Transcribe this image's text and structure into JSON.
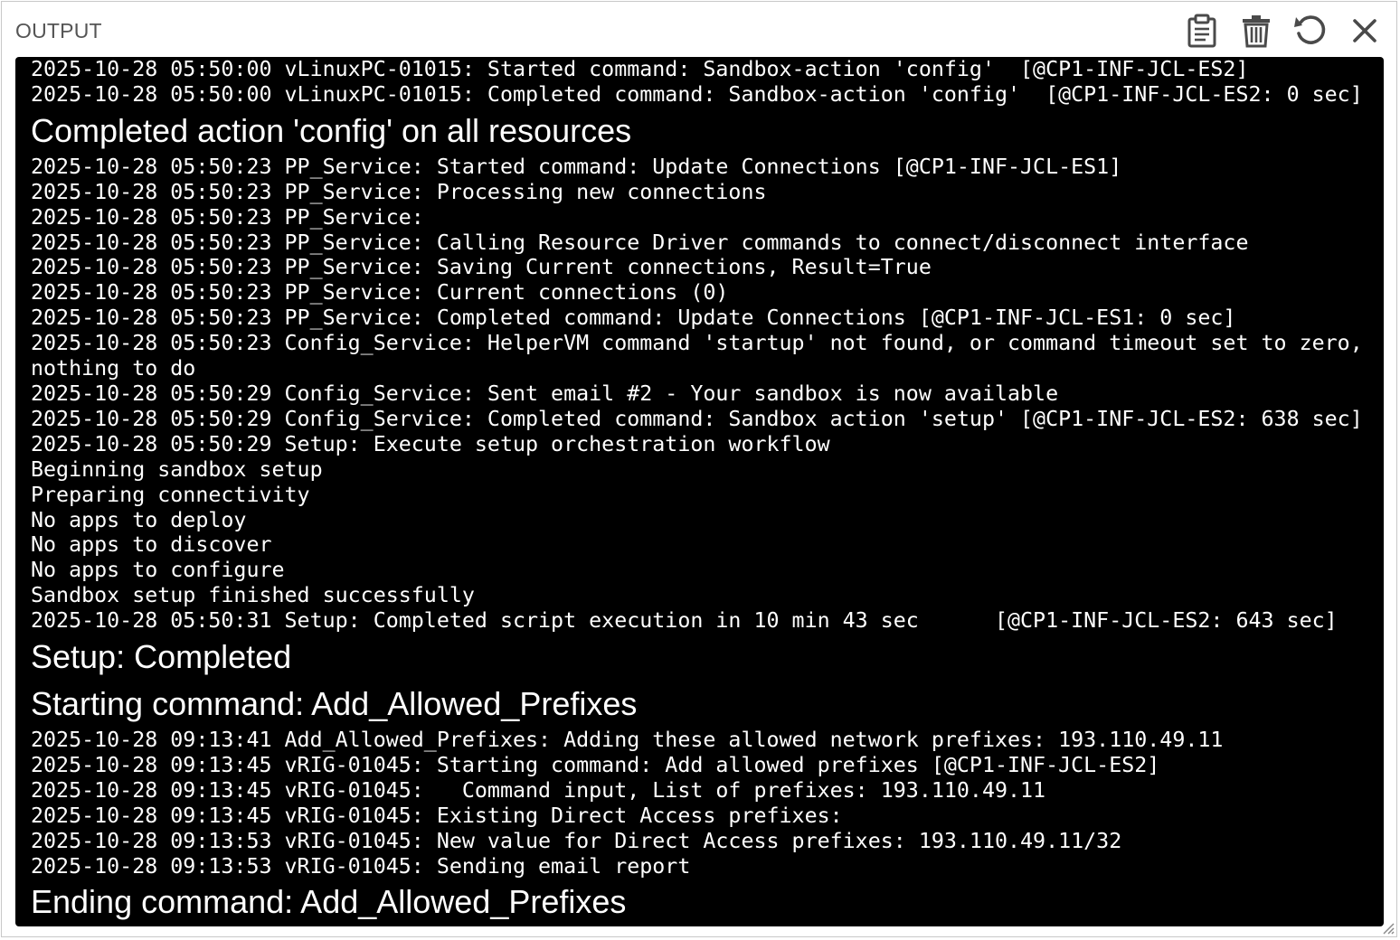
{
  "panel": {
    "title": "OUTPUT"
  },
  "toolbar": {
    "copy_icon": "clipboard-icon",
    "clear_icon": "trash-icon",
    "refresh_icon": "refresh-icon",
    "close_icon": "close-icon"
  },
  "colors": {
    "console_background": "#000000",
    "console_text": "#ffffff",
    "icon": "#4a4a4a",
    "title": "#555555"
  },
  "log": [
    {
      "kind": "line",
      "text": "2025-10-28 05:50:00 vLinuxPC-01015: Started command: Sandbox-action 'config'  [@CP1-INF-JCL-ES2]"
    },
    {
      "kind": "line",
      "text": "2025-10-28 05:50:00 vLinuxPC-01015: Completed command: Sandbox-action 'config'  [@CP1-INF-JCL-ES2: 0 sec]"
    },
    {
      "kind": "heading",
      "text": "Completed action 'config' on all resources"
    },
    {
      "kind": "line",
      "text": "2025-10-28 05:50:23 PP_Service: Started command: Update Connections [@CP1-INF-JCL-ES1]"
    },
    {
      "kind": "line",
      "text": "2025-10-28 05:50:23 PP_Service: Processing new connections"
    },
    {
      "kind": "line",
      "text": "2025-10-28 05:50:23 PP_Service: "
    },
    {
      "kind": "line",
      "text": "2025-10-28 05:50:23 PP_Service: Calling Resource Driver commands to connect/disconnect interface"
    },
    {
      "kind": "line",
      "text": "2025-10-28 05:50:23 PP_Service: Saving Current connections, Result=True"
    },
    {
      "kind": "line",
      "text": "2025-10-28 05:50:23 PP_Service: Current connections (0)"
    },
    {
      "kind": "line",
      "text": "2025-10-28 05:50:23 PP_Service: Completed command: Update Connections [@CP1-INF-JCL-ES1: 0 sec]"
    },
    {
      "kind": "line",
      "text": "2025-10-28 05:50:23 Config_Service: HelperVM command 'startup' not found, or command timeout set to zero, nothing to do"
    },
    {
      "kind": "line",
      "text": "2025-10-28 05:50:29 Config_Service: Sent email #2 - Your sandbox is now available"
    },
    {
      "kind": "line",
      "text": "2025-10-28 05:50:29 Config_Service: Completed command: Sandbox action 'setup' [@CP1-INF-JCL-ES2: 638 sec]"
    },
    {
      "kind": "line",
      "text": "2025-10-28 05:50:29 Setup: Execute setup orchestration workflow"
    },
    {
      "kind": "line",
      "text": "Beginning sandbox setup"
    },
    {
      "kind": "line",
      "text": "Preparing connectivity"
    },
    {
      "kind": "line",
      "text": "No apps to deploy"
    },
    {
      "kind": "line",
      "text": "No apps to discover"
    },
    {
      "kind": "line",
      "text": "No apps to configure"
    },
    {
      "kind": "line",
      "text": "Sandbox setup finished successfully"
    },
    {
      "kind": "line",
      "text": "2025-10-28 05:50:31 Setup: Completed script execution in 10 min 43 sec      [@CP1-INF-JCL-ES2: 643 sec]"
    },
    {
      "kind": "heading",
      "text": "Setup: Completed"
    },
    {
      "kind": "heading",
      "text": "Starting command: Add_Allowed_Prefixes"
    },
    {
      "kind": "line",
      "text": "2025-10-28 09:13:41 Add_Allowed_Prefixes: Adding these allowed network prefixes: 193.110.49.11"
    },
    {
      "kind": "line",
      "text": "2025-10-28 09:13:45 vRIG-01045: Starting command: Add allowed prefixes [@CP1-INF-JCL-ES2]"
    },
    {
      "kind": "line",
      "text": "2025-10-28 09:13:45 vRIG-01045:   Command input, List of prefixes: 193.110.49.11"
    },
    {
      "kind": "line",
      "text": "2025-10-28 09:13:45 vRIG-01045: Existing Direct Access prefixes: "
    },
    {
      "kind": "line",
      "text": "2025-10-28 09:13:53 vRIG-01045: New value for Direct Access prefixes: 193.110.49.11/32"
    },
    {
      "kind": "line",
      "text": "2025-10-28 09:13:53 vRIG-01045: Sending email report"
    },
    {
      "kind": "heading",
      "text": "Ending command: Add_Allowed_Prefixes"
    }
  ]
}
